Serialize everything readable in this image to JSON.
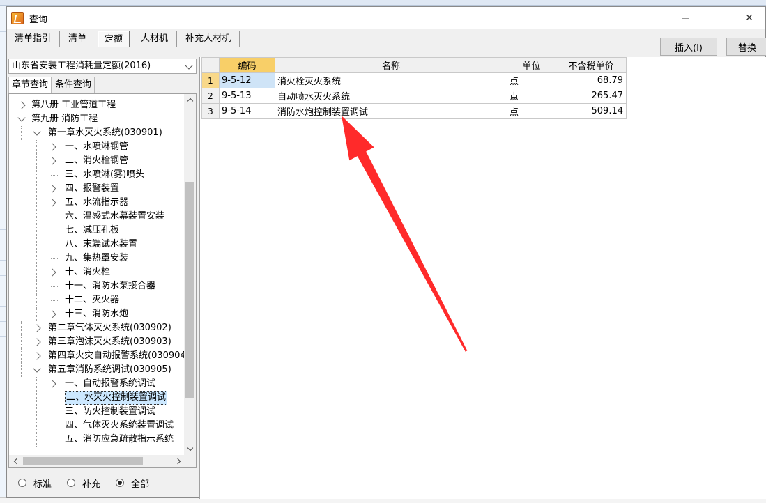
{
  "window": {
    "title": "查询"
  },
  "tabs": [
    "清单指引",
    "清单",
    "定额",
    "人材机",
    "补充人材机"
  ],
  "buttons": {
    "insert": "插入(I)",
    "replace": "替换"
  },
  "left": {
    "dropdown_value": "山东省安装工程消耗量定额(2016)",
    "subtabs": [
      "章节查询",
      "条件查询"
    ],
    "tree": [
      {
        "label": "第八册 工业管道工程",
        "level": 0,
        "state": "collapsed"
      },
      {
        "label": "第九册 消防工程",
        "level": 0,
        "state": "expanded"
      },
      {
        "label": "第一章水灭火系统(030901)",
        "level": 1,
        "state": "expanded"
      },
      {
        "label": "一、水喷淋钢管",
        "level": 2,
        "state": "collapsed"
      },
      {
        "label": "二、消火栓钢管",
        "level": 2,
        "state": "collapsed"
      },
      {
        "label": "三、水喷淋(雾)喷头",
        "level": 2,
        "state": "leaf"
      },
      {
        "label": "四、报警装置",
        "level": 2,
        "state": "collapsed"
      },
      {
        "label": "五、水流指示器",
        "level": 2,
        "state": "collapsed"
      },
      {
        "label": "六、温感式水幕装置安装",
        "level": 2,
        "state": "leaf"
      },
      {
        "label": "七、减压孔板",
        "level": 2,
        "state": "leaf"
      },
      {
        "label": "八、末端试水装置",
        "level": 2,
        "state": "leaf"
      },
      {
        "label": "九、集热罩安装",
        "level": 2,
        "state": "leaf"
      },
      {
        "label": "十、消火栓",
        "level": 2,
        "state": "collapsed"
      },
      {
        "label": "十一、消防水泵接合器",
        "level": 2,
        "state": "leaf"
      },
      {
        "label": "十二、灭火器",
        "level": 2,
        "state": "leaf"
      },
      {
        "label": "十三、消防水炮",
        "level": 2,
        "state": "collapsed"
      },
      {
        "label": "第二章气体灭火系统(030902)",
        "level": 1,
        "state": "collapsed"
      },
      {
        "label": "第三章泡沫灭火系统(030903)",
        "level": 1,
        "state": "collapsed"
      },
      {
        "label": "第四章火灾自动报警系统(030904)",
        "level": 1,
        "state": "collapsed"
      },
      {
        "label": "第五章消防系统调试(030905)",
        "level": 1,
        "state": "expanded"
      },
      {
        "label": "一、自动报警系统调试",
        "level": 2,
        "state": "collapsed"
      },
      {
        "label": "二、水灭火控制装置调试",
        "level": 2,
        "state": "leaf",
        "selected": true
      },
      {
        "label": "三、防火控制装置调试",
        "level": 2,
        "state": "leaf"
      },
      {
        "label": "四、气体灭火系统装置调试",
        "level": 2,
        "state": "leaf"
      },
      {
        "label": "五、消防应急疏散指示系统",
        "level": 2,
        "state": "leaf"
      }
    ],
    "filters": [
      {
        "label": "标准",
        "checked": false
      },
      {
        "label": "补充",
        "checked": false
      },
      {
        "label": "全部",
        "checked": true
      }
    ]
  },
  "grid": {
    "columns": [
      "编码",
      "名称",
      "单位",
      "不含税单价"
    ],
    "rows": [
      {
        "num": "1",
        "code": "9-5-12",
        "name": "消火栓灭火系统",
        "unit": "点",
        "price": "68.79"
      },
      {
        "num": "2",
        "code": "9-5-13",
        "name": "自动喷水灭火系统",
        "unit": "点",
        "price": "265.47"
      },
      {
        "num": "3",
        "code": "9-5-14",
        "name": "消防水炮控制装置调试",
        "unit": "点",
        "price": "509.14"
      }
    ]
  },
  "annotation": {
    "arrow_color": "#ff2a2a"
  }
}
